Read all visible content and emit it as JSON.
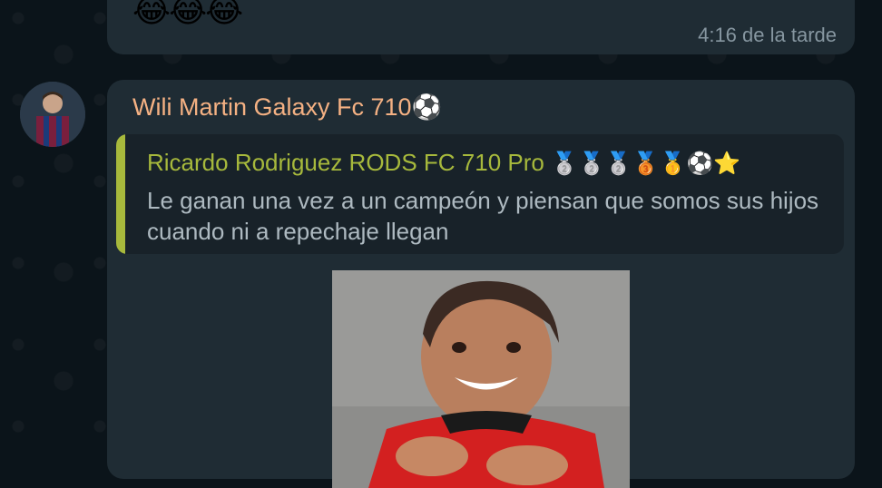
{
  "previous_message": {
    "emojis": "😂😂😂",
    "time": "4:16 de la tarde"
  },
  "message": {
    "sender": "Wili Martin Galaxy Fc 710⚽",
    "quote": {
      "author": "Ricardo Rodriguez RODS FC 710 Pro",
      "author_emojis": "🥈🥈🥈🥉🥇⚽⭐",
      "text": "Le ganan una vez a un campeón y piensan que somos sus hijos cuando ni a repechaje llegan"
    }
  },
  "colors": {
    "bubble": "#1f2c34",
    "sender": "#f4b183",
    "quote_author": "#a7b93c",
    "background": "#0b141a"
  }
}
